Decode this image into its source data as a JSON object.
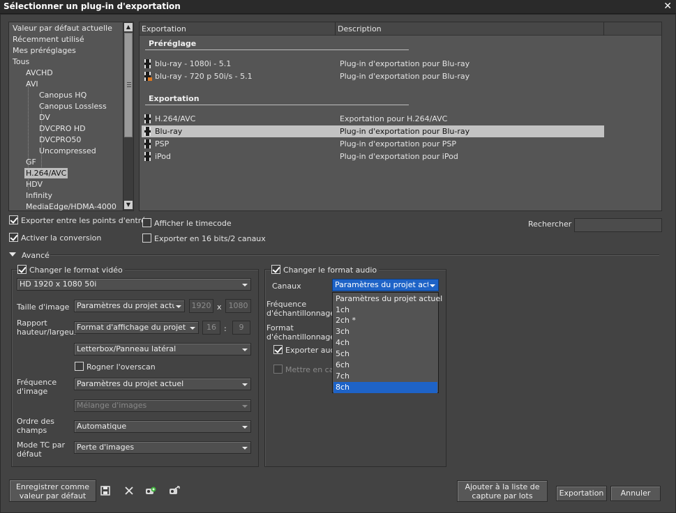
{
  "window": {
    "title": "Sélectionner un plug-in d'exportation",
    "close_glyph": "✕"
  },
  "tree": {
    "items": [
      "Valeur par défaut actuelle",
      "Récemment utilisé",
      "Mes préréglages",
      "Tous",
      "AVCHD",
      "AVI",
      "Canopus HQ",
      "Canopus Lossless",
      "DV",
      "DVCPRO HD",
      "DVCPRO50",
      "Uncompressed",
      "GF",
      "H.264/AVC",
      "HDV",
      "Infinity",
      "MediaEdge/HDMA-4000"
    ],
    "selected": "H.264/AVC"
  },
  "list": {
    "col_export": "Exportation",
    "col_description": "Description",
    "group_preset": "Préréglage",
    "group_export": "Exportation",
    "presets": [
      {
        "name": "blu-ray - 1080i - 5.1",
        "description": "Plug-in d'exportation pour Blu-ray",
        "icon": "film-icon"
      },
      {
        "name": "blu-ray - 720 p 50i/s - 5.1",
        "description": "Plug-in d'exportation pour Blu-ray",
        "icon": "film-preset-icon"
      }
    ],
    "exports": [
      {
        "name": "H.264/AVC",
        "description": "Exportation pour H.264/AVC"
      },
      {
        "name": "Blu-ray",
        "description": "Plug-in d'exportation pour Blu-ray"
      },
      {
        "name": "PSP",
        "description": "Plug-in d'exportation pour PSP"
      },
      {
        "name": "iPod",
        "description": "Plug-in d'exportation pour iPod"
      }
    ],
    "selected_export": "Blu-ray"
  },
  "options": {
    "export_between_in_out": "Exporter entre les points d'entrée",
    "enable_conversion": "Activer la conversion",
    "show_timecode": "Afficher le timecode",
    "export_16bit": "Exporter en 16 bits/2 canaux",
    "search_label": "Rechercher",
    "search_value": ""
  },
  "advanced": {
    "label": "Avancé",
    "video": {
      "change_format": "Changer le format vidéo",
      "format": "HD 1920 x 1080 50i",
      "image_size_label": "Taille d'image",
      "image_size": "Paramètres du projet actuel",
      "width": "1920",
      "x_sep": "x",
      "height": "1080",
      "aspect_label": "Rapport hauteur/largeur",
      "aspect": "Format d'affichage du projet actuel",
      "ratio_w": "16",
      "ratio_sep": ":",
      "ratio_h": "9",
      "letterbox": "Letterbox/Panneau latéral",
      "crop_overscan": "Rogner l'overscan",
      "frame_rate_label": "Fréquence d'image",
      "frame_rate": "Paramètres du projet actuel",
      "blend": "Mélange d'images",
      "field_order_label": "Ordre des champs",
      "field_order": "Automatique",
      "tc_mode_label": "Mode TC par défaut",
      "tc_mode": "Perte d'images"
    },
    "audio": {
      "change_format": "Changer le format audio",
      "channels_label": "Canaux",
      "channels": "Paramètres du projet actue",
      "sample_rate_label": "Fréquence d'échantillonnage",
      "sample_format_label": "Format d'échantillonnage",
      "export_audio": "Exporter audi",
      "cache": "Mettre en cac",
      "channel_options": [
        "Paramètres du projet actuel",
        "1ch",
        "2ch *",
        "3ch",
        "4ch",
        "5ch",
        "6ch",
        "7ch",
        "8ch"
      ],
      "highlighted_option": "8ch"
    }
  },
  "footer": {
    "save_default": "Enregistrer comme valeur par défaut",
    "add_batch": "Ajouter à la liste de capture par lots",
    "export": "Exportation",
    "cancel": "Annuler"
  },
  "colors": {
    "background": "#434343",
    "selection_gray": "#c3c3c3",
    "highlight_blue": "#1e63c7",
    "accent_orange": "#e0781d"
  }
}
